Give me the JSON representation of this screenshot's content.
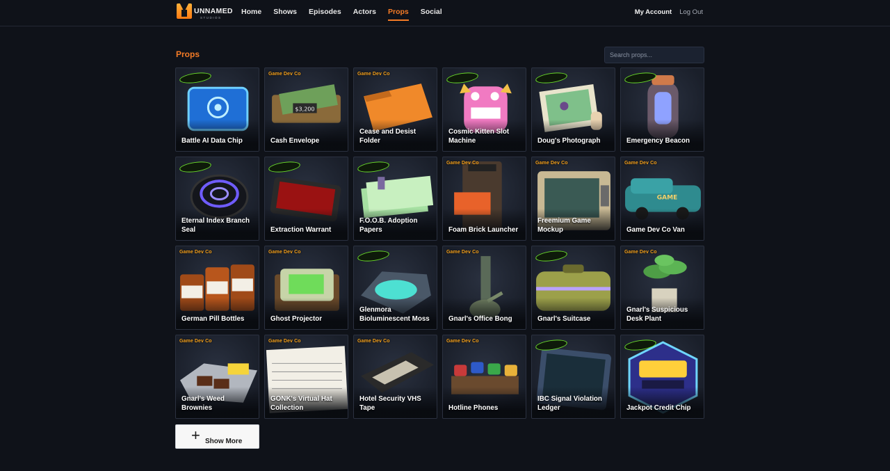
{
  "header": {
    "logo_text": "UNNAMED",
    "logo_sub": "STUDIOS",
    "nav": [
      "Home",
      "Shows",
      "Episodes",
      "Actors",
      "Props",
      "Social"
    ],
    "active_nav": "Props",
    "my_account": "My Account",
    "log_out": "Log Out"
  },
  "main": {
    "title": "Props",
    "search_placeholder": "Search props...",
    "show_more_label": "Show More"
  },
  "colors": {
    "accent": "#f47b26",
    "background": "#0f1219",
    "card_border": "#2b3140"
  },
  "props": [
    {
      "name": "Battle AI Data Chip",
      "badge": "wordmark",
      "icon": "data-chip-icon"
    },
    {
      "name": "Cash Envelope",
      "badge": "Game Dev Co",
      "icon": "cash-envelope-icon"
    },
    {
      "name": "Cease and Desist Folder",
      "badge": "Game Dev Co",
      "icon": "folder-icon"
    },
    {
      "name": "Cosmic Kitten Slot Machine",
      "badge": "wordmark",
      "icon": "slot-machine-icon"
    },
    {
      "name": "Doug's Photograph",
      "badge": "wordmark",
      "icon": "photograph-icon"
    },
    {
      "name": "Emergency Beacon",
      "badge": "wordmark",
      "icon": "beacon-icon"
    },
    {
      "name": "Eternal Index Branch Seal",
      "badge": "wordmark",
      "icon": "seal-icon"
    },
    {
      "name": "Extraction Warrant",
      "badge": "wordmark",
      "icon": "tablet-icon"
    },
    {
      "name": "F.O.O.B. Adoption Papers",
      "badge": "wordmark",
      "icon": "papers-icon"
    },
    {
      "name": "Foam Brick Launcher",
      "badge": "Game Dev Co",
      "icon": "launcher-icon"
    },
    {
      "name": "Freemium Game Mockup",
      "badge": "Game Dev Co",
      "icon": "arcade-icon"
    },
    {
      "name": "Game Dev Co Van",
      "badge": "Game Dev Co",
      "icon": "van-icon"
    },
    {
      "name": "German Pill Bottles",
      "badge": "Game Dev Co",
      "icon": "pill-bottles-icon"
    },
    {
      "name": "Ghost Projector",
      "badge": "Game Dev Co",
      "icon": "projector-icon"
    },
    {
      "name": "Glenmora Bioluminescent Moss",
      "badge": "wordmark",
      "icon": "moss-icon"
    },
    {
      "name": "Gnarl's Office Bong",
      "badge": "Game Dev Co",
      "icon": "bong-icon"
    },
    {
      "name": "Gnarl's Suitcase",
      "badge": "wordmark",
      "icon": "suitcase-icon"
    },
    {
      "name": "Gnarl's Suspicious Desk Plant",
      "badge": "Game Dev Co",
      "icon": "plant-icon"
    },
    {
      "name": "Gnarl's Weed Brownies",
      "badge": "Game Dev Co",
      "icon": "brownies-icon"
    },
    {
      "name": "GONK's Virtual Hat Collection",
      "badge": "Game Dev Co",
      "icon": "ledger-sheet-icon"
    },
    {
      "name": "Hotel Security VHS Tape",
      "badge": "Game Dev Co",
      "icon": "vhs-icon"
    },
    {
      "name": "Hotline Phones",
      "badge": "Game Dev Co",
      "icon": "phones-icon"
    },
    {
      "name": "IBC Signal Violation Ledger",
      "badge": "wordmark",
      "icon": "ledger-tablet-icon"
    },
    {
      "name": "Jackpot Credit Chip",
      "badge": "wordmark",
      "icon": "credit-chip-icon"
    }
  ]
}
